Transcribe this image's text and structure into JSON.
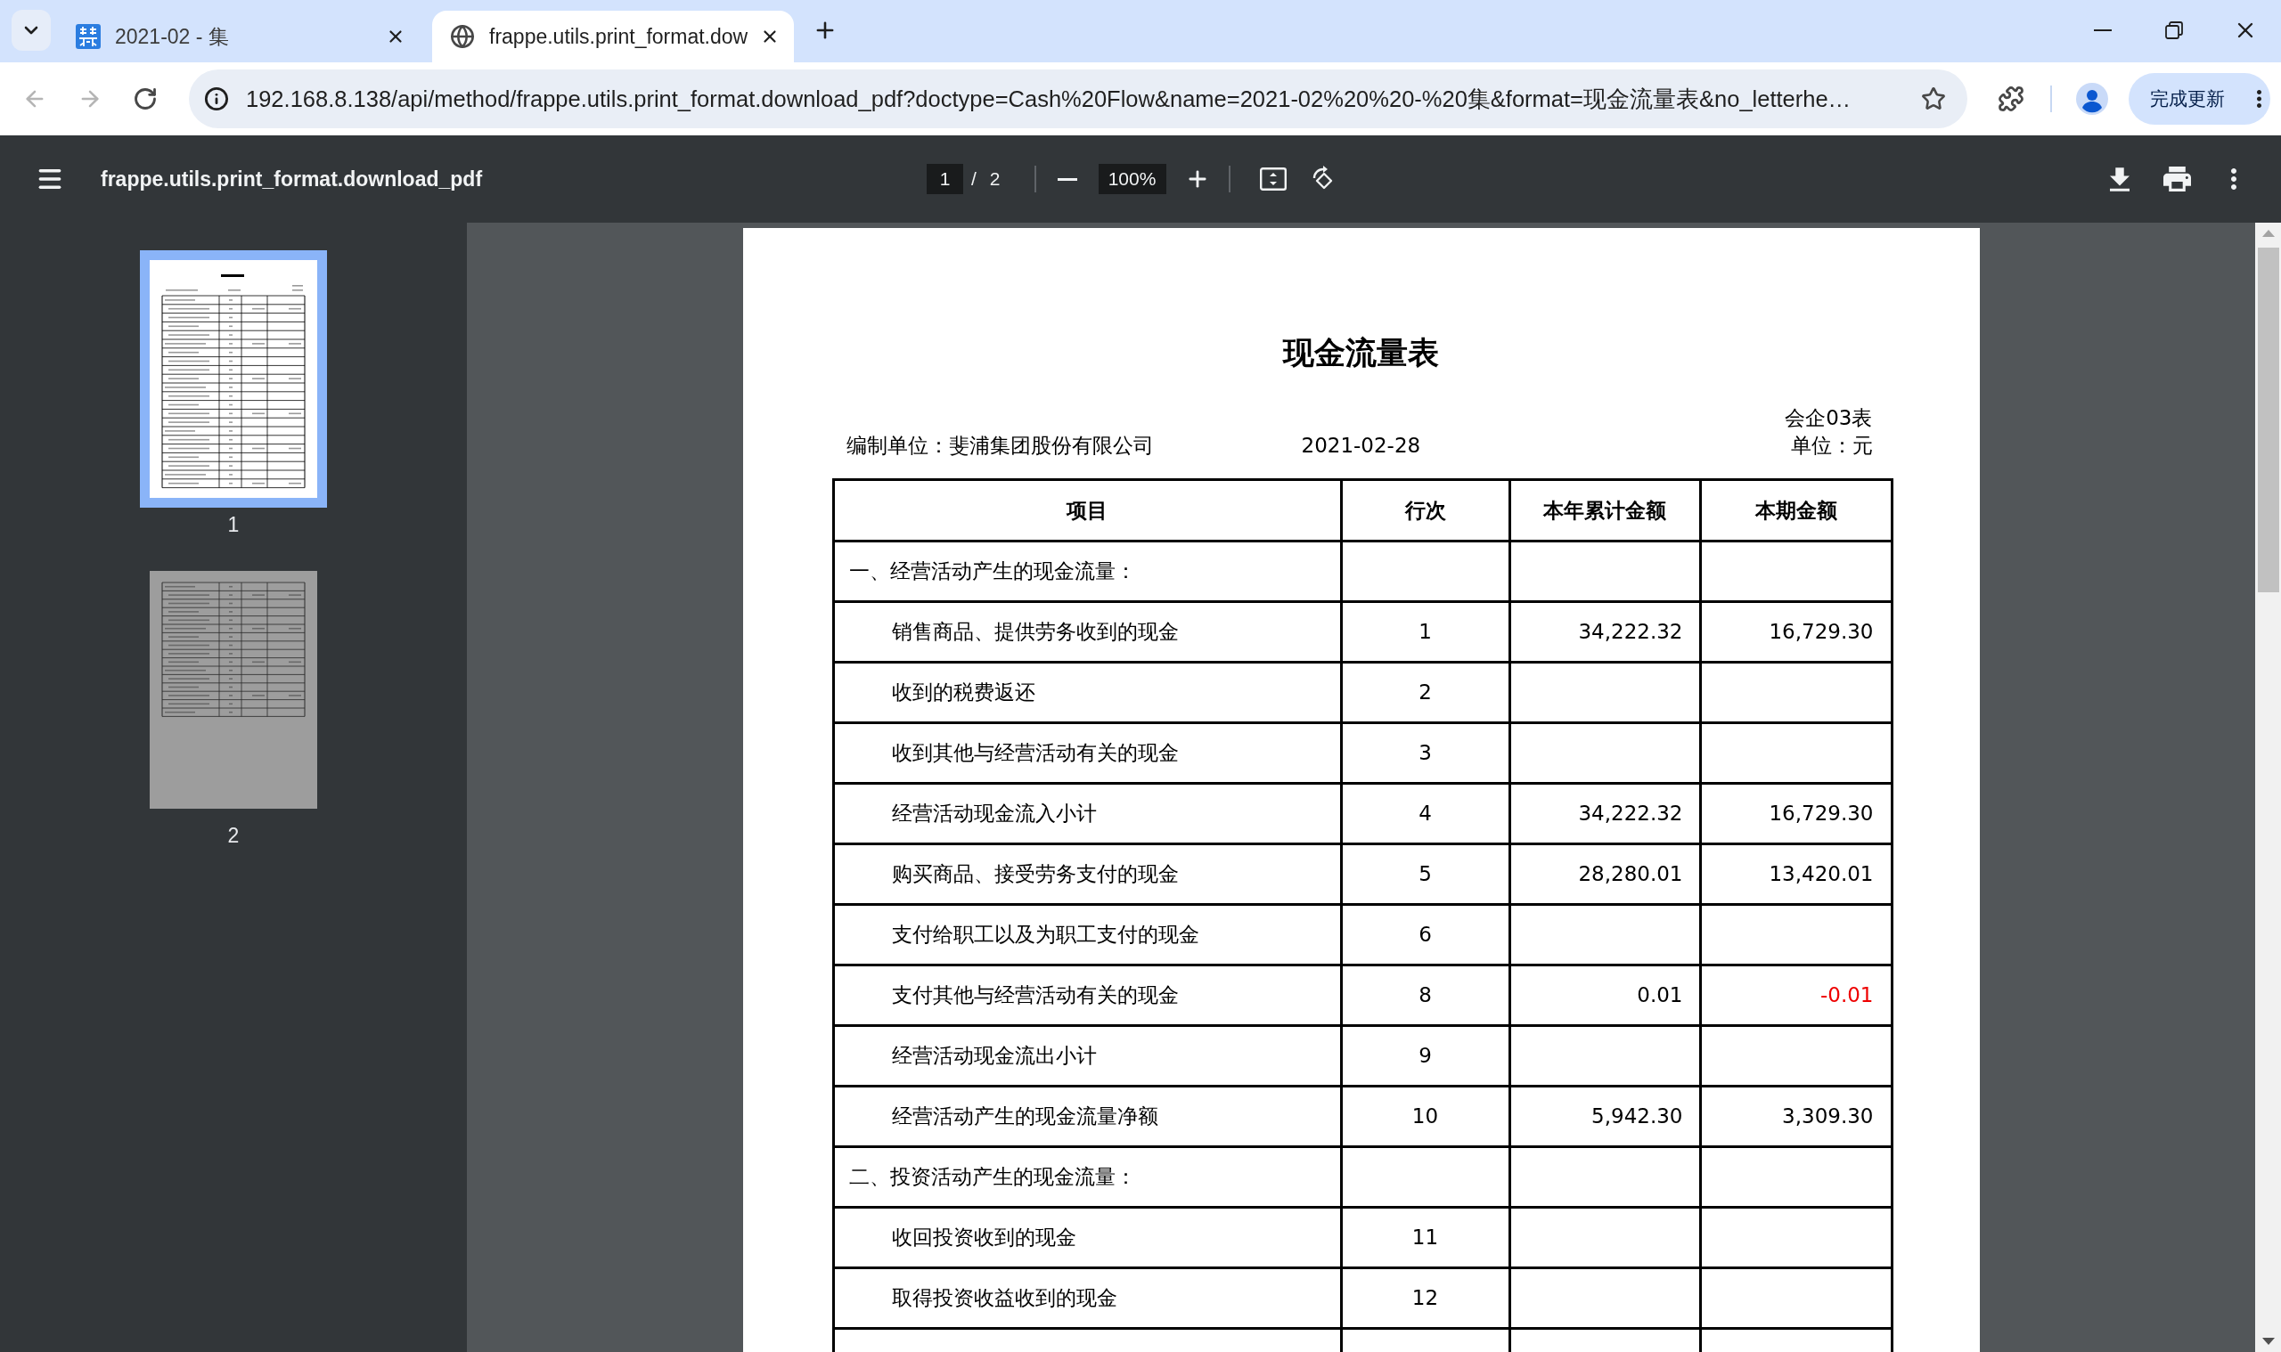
{
  "browser": {
    "tabs": [
      {
        "title": "2021-02 - 集",
        "selected": false
      },
      {
        "title": "frappe.utils.print_format.dow",
        "selected": true
      }
    ],
    "back_disabled": true,
    "forward_disabled": true,
    "address": "192.168.8.138/api/method/frappe.utils.print_format.download_pdf?doctype=Cash%20Flow&name=2021-02%20%20-%20集&format=现金流量表&no_letterhe…",
    "update_button": "完成更新"
  },
  "pdf_toolbar": {
    "title": "frappe.utils.print_format.download_pdf",
    "current_page": "1",
    "page_separator": "/",
    "page_count": "2",
    "zoom": "100%"
  },
  "thumbnails": [
    {
      "label": "1",
      "selected": true
    },
    {
      "label": "2",
      "selected": false
    }
  ],
  "document": {
    "title": "现金流量表",
    "form_code": "会企03表",
    "company": "编制单位：斐浦集团股份有限公司",
    "date": "2021-02-28",
    "unit": "单位：元",
    "table": {
      "columns": [
        "项目",
        "行次",
        "本年累计金额",
        "本期金额"
      ],
      "rows": [
        {
          "kind": "section",
          "item": "一、经营活动产生的现金流量："
        },
        {
          "kind": "line",
          "item": "销售商品、提供劳务收到的现金",
          "line_no": "1",
          "ytd_amount": "34,222.32",
          "period_amount": "16,729.30",
          "period_negative": false
        },
        {
          "kind": "line",
          "item": "收到的税费返还",
          "line_no": "2"
        },
        {
          "kind": "line",
          "item": "收到其他与经营活动有关的现金",
          "line_no": "3"
        },
        {
          "kind": "line",
          "item": "经营活动现金流入小计",
          "line_no": "4",
          "ytd_amount": "34,222.32",
          "period_amount": "16,729.30",
          "period_negative": false
        },
        {
          "kind": "line",
          "item": "购买商品、接受劳务支付的现金",
          "line_no": "5",
          "ytd_amount": "28,280.01",
          "period_amount": "13,420.01",
          "period_negative": false
        },
        {
          "kind": "line",
          "item": "支付给职工以及为职工支付的现金",
          "line_no": "6"
        },
        {
          "kind": "line",
          "item": "支付其他与经营活动有关的现金",
          "line_no": "8",
          "ytd_amount": "0.01",
          "period_amount": "-0.01",
          "period_negative": true
        },
        {
          "kind": "line",
          "item": "经营活动现金流出小计",
          "line_no": "9"
        },
        {
          "kind": "line",
          "item": "经营活动产生的现金流量净额",
          "line_no": "10",
          "ytd_amount": "5,942.30",
          "period_amount": "3,309.30",
          "period_negative": false
        },
        {
          "kind": "section",
          "item": "二、投资活动产生的现金流量："
        },
        {
          "kind": "line",
          "item": "收回投资收到的现金",
          "line_no": "11"
        },
        {
          "kind": "line",
          "item": "取得投资收益收到的现金",
          "line_no": "12"
        }
      ]
    }
  }
}
